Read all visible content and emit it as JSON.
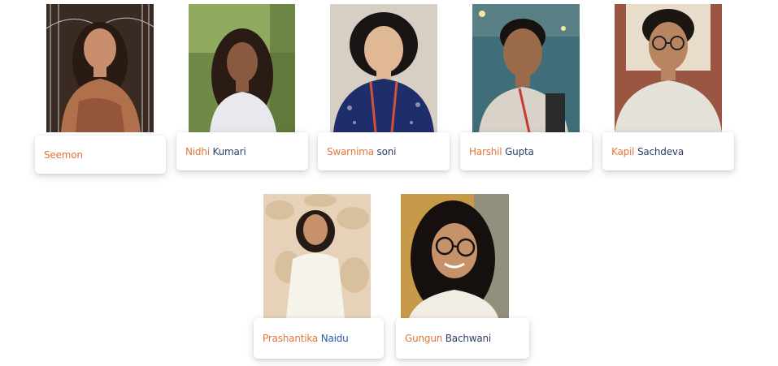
{
  "team": {
    "members": [
      {
        "first": "Seemon",
        "last": "",
        "bg": "#6b4a3a",
        "skin": "#c98e6c",
        "hair": "#2a1a14",
        "outfit": "#b0704c"
      },
      {
        "first": "Nidhi",
        "last": "Kumari",
        "bg": "#8ba35a",
        "skin": "#8a5a40",
        "hair": "#2b1b15",
        "outfit": "#e8e8ee"
      },
      {
        "first": "Swarnima",
        "last": "soni",
        "bg": "#d7cfc4",
        "skin": "#e0b895",
        "hair": "#1a1414",
        "outfit": "#1e2e6a"
      },
      {
        "first": "Harshil",
        "last": "Gupta",
        "bg": "#3f6d7a",
        "skin": "#9b6a4a",
        "hair": "#161210",
        "outfit": "#d8d2c8"
      },
      {
        "first": "Kapil",
        "last": "Sachdeva",
        "bg": "#9a5642",
        "skin": "#b98561",
        "hair": "#1c1612",
        "outfit": "#e4e2d8"
      },
      {
        "first": "Prashantika",
        "last": "Naidu",
        "bg": "#e5d2b8",
        "skin": "#c6916b",
        "hair": "#261a14",
        "outfit": "#f6f3ea"
      },
      {
        "first": "Gungun",
        "last": "Bachwani",
        "bg": "#c79a4a",
        "skin": "#c5926a",
        "hair": "#150f0d",
        "outfit": "#f1ece4"
      }
    ]
  }
}
